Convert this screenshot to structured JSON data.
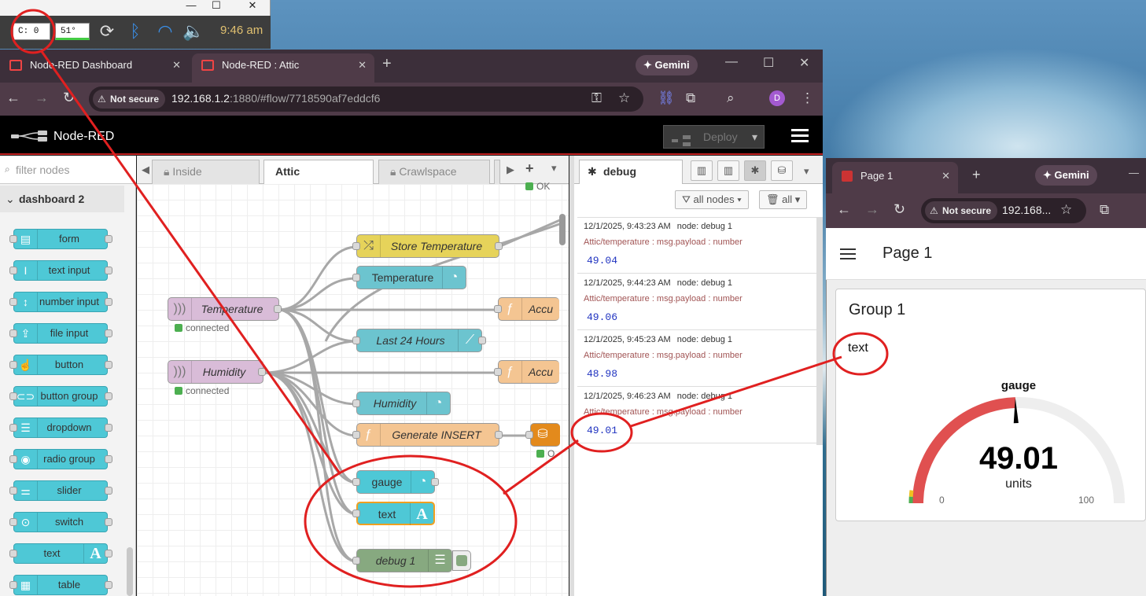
{
  "tray": {
    "cpu": "C: 0",
    "temp": "51°",
    "clock": "9:46 am",
    "min_glyph": "—",
    "max_glyph": "☐",
    "close_glyph": "✕"
  },
  "browser": {
    "tabs": [
      {
        "label": "Node-RED Dashboard"
      },
      {
        "label": "Node-RED : Attic"
      }
    ],
    "new_tab": "+",
    "gemini": "Gemini",
    "not_secure": "Not secure",
    "url_host": "192.168.1.2",
    "url_path": ":1880/#flow/7718590af7eddcf6",
    "avatar": "D"
  },
  "nodered": {
    "title": "Node-RED",
    "deploy": "Deploy",
    "filter_placeholder": "filter nodes",
    "category": "dashboard 2",
    "palette": [
      "form",
      "text input",
      "number input",
      "file input",
      "button",
      "button group",
      "dropdown",
      "radio group",
      "slider",
      "switch",
      "text",
      "table"
    ],
    "tabs": [
      {
        "label": "Inside",
        "locked": true
      },
      {
        "label": "Attic",
        "locked": false
      },
      {
        "label": "Crawlspace",
        "locked": true
      }
    ],
    "flow": {
      "ok_top": "OK",
      "store_temperature": "Store Temperature",
      "temperature_gauge": "Temperature",
      "temperature_in": "Temperature",
      "accu1": "Accu",
      "connected": "connected",
      "last24": "Last 24 Hours",
      "humidity_in": "Humidity",
      "accu2": "Accu",
      "humidity_gauge": "Humidity",
      "generate_insert": "Generate INSERT",
      "db_status": "O",
      "gauge": "gauge",
      "text": "text",
      "debug": "debug 1"
    }
  },
  "debug": {
    "tab": "debug",
    "filter_nodes": "all nodes",
    "clear": "all",
    "messages": [
      {
        "time": "12/1/2025, 9:43:23 AM",
        "node": "node: debug 1",
        "topic": "Attic/temperature : msg.payload : number",
        "value": "49.04"
      },
      {
        "time": "12/1/2025, 9:44:23 AM",
        "node": "node: debug 1",
        "topic": "Attic/temperature : msg.payload : number",
        "value": "49.06"
      },
      {
        "time": "12/1/2025, 9:45:23 AM",
        "node": "node: debug 1",
        "topic": "Attic/temperature : msg.payload : number",
        "value": "48.98"
      },
      {
        "time": "12/1/2025, 9:46:23 AM",
        "node": "node: debug 1",
        "topic": "Attic/temperature : msg.payload : number",
        "value": "49.01"
      }
    ]
  },
  "dashboard": {
    "tab": "Page 1",
    "gemini": "Gemini",
    "not_secure": "Not secure",
    "url": "192.168...",
    "page_title": "Page 1",
    "group": "Group 1",
    "text_widget": "text",
    "gauge": {
      "label": "gauge",
      "value": "49.01",
      "units": "units",
      "min": "0",
      "max": "100",
      "fraction": 0.4901
    }
  },
  "colors": {
    "node_red_accent": "#c02020",
    "dashboard_cyan": "#4ec8d6",
    "annotation_red": "#e02020",
    "gauge_red": "#e05050"
  }
}
